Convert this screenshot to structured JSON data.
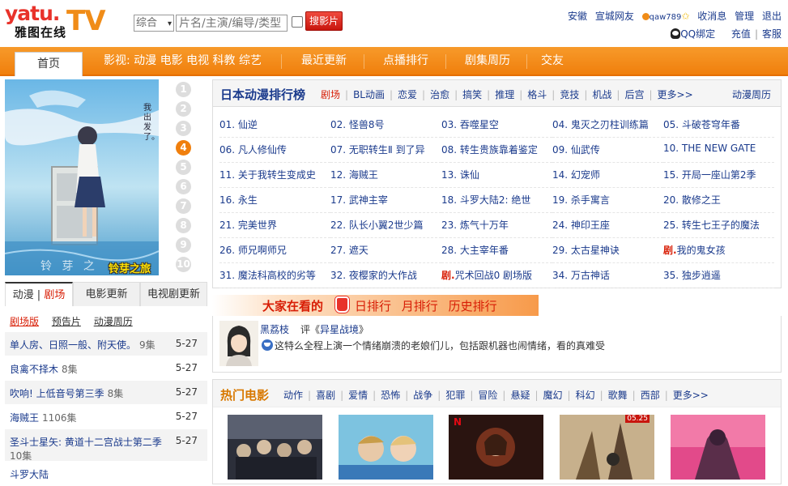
{
  "header": {
    "logo_main": "yatu.",
    "logo_sub": "雅图在线",
    "logo_tv": "TV",
    "search_type": "综合",
    "search_placeholder": "片名/主演/编导/类型",
    "search_button": "搜影片",
    "top_links": {
      "region": "安徽",
      "site": "宣城网友",
      "username": "qaw789",
      "messages": "收消息",
      "manage": "管理",
      "logout": "退出",
      "qq_bind": "QQ绑定",
      "recharge": "充值",
      "service": "客服"
    }
  },
  "nav": {
    "home": "首页",
    "items": [
      "影视: 动漫 电影 电视 科教 综艺",
      "最近更新",
      "点播排行",
      "剧集周历",
      "交友"
    ]
  },
  "poster": {
    "title_vertical": "我出发了。",
    "caption": "铃芽之旅",
    "watermark": "铃 芽 之"
  },
  "rank_numbers": [
    "1",
    "2",
    "3",
    "4",
    "5",
    "6",
    "7",
    "8",
    "9",
    "10"
  ],
  "left_tabs": {
    "tab1_a": "动漫",
    "tab1_sep": "|",
    "tab1_b": "剧场",
    "tab2": "电影更新",
    "tab3": "电视剧更新"
  },
  "left_sub": [
    "剧场版",
    "预告片",
    "动漫周历"
  ],
  "left_list": [
    {
      "title": "单人房、日照一般、附天使。",
      "count": "9集",
      "date": "5-27"
    },
    {
      "title": "良禽不择木",
      "count": "8集",
      "date": "5-27"
    },
    {
      "title": "吹响! 上低音号第三季",
      "count": "8集",
      "date": "5-27"
    },
    {
      "title": "海贼王",
      "count": "1106集",
      "date": "5-27"
    },
    {
      "title": "圣斗士星矢: 黄道十二宫战士第二季",
      "count": "10集",
      "date": "5-27"
    },
    {
      "title": "斗罗大陆",
      "count": "",
      "date": ""
    }
  ],
  "anime": {
    "title": "日本动漫排行榜",
    "cats": [
      "剧场",
      "BL动画",
      "恋爱",
      "治愈",
      "搞笑",
      "推理",
      "格斗",
      "竞技",
      "机战",
      "后宫",
      "更多>>"
    ],
    "more": "动漫周历",
    "ju_label": "剧.",
    "items": [
      "01. 仙逆",
      "02. 怪兽8号",
      "03. 吞噬星空",
      "04. 鬼灭之刃柱训练篇",
      "05. 斗破苍穹年番",
      "06. 凡人修仙传",
      "07. 无职转生Ⅱ 到了异",
      "08. 转生贵族靠着鉴定",
      "09. 仙武传",
      "10. THE NEW GATE",
      "11. 关于我转生变成史",
      "12. 海贼王",
      "13. 诛仙",
      "14. 幻宠师",
      "15. 开局一座山第2季",
      "16. 永生",
      "17. 武神主宰",
      "18. 斗罗大陆2: 绝世",
      "19. 杀手寓言",
      "20. 散修之王",
      "21. 完美世界",
      "22. 队长小翼2世少篇",
      "23. 炼气十万年",
      "24. 神印王座",
      "25. 转生七王子的魔法",
      "26. 师兄啊师兄",
      "27. 遮天",
      "28. 大主宰年番",
      "29. 太古星神诀",
      "我的鬼女孩",
      "31. 魔法科高校的劣等",
      "32. 夜樱家的大作战",
      "咒术回战0 剧场版",
      "34. 万古神话",
      "35. 独步逍遥"
    ]
  },
  "watching": {
    "title": "大家在看的",
    "links": [
      "日排行",
      "月排行",
      "历史排行"
    ],
    "commenter": "黑荔枝",
    "comment_prefix": "评《",
    "comment_movie": "异星战境",
    "comment_suffix": "》",
    "comment": "这特么全程上演一个情绪崩溃的老娘们儿，包括跟机器也闹情绪，看的真难受"
  },
  "movies": {
    "title": "热门电影",
    "cats": [
      "动作",
      "喜剧",
      "爱情",
      "恐怖",
      "战争",
      "犯罪",
      "冒险",
      "悬疑",
      "魔幻",
      "科幻",
      "歌舞",
      "西部",
      "更多>>"
    ],
    "badge_n": "N",
    "date_badge": "05.25"
  },
  "colors": {
    "nav_orange": "#f07f0d",
    "link_blue": "#1a3a8c",
    "accent_red": "#d81e06"
  }
}
